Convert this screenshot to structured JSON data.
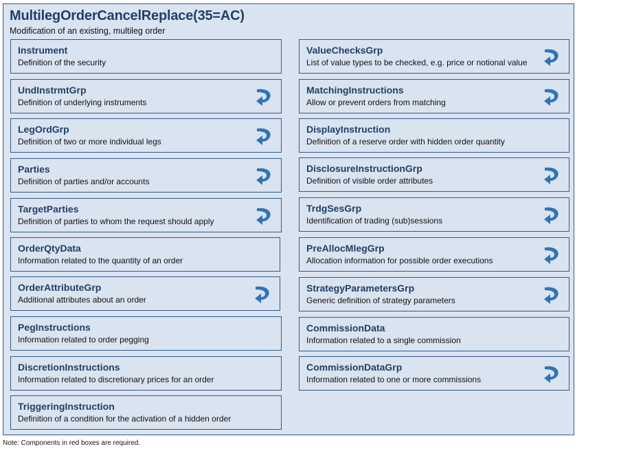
{
  "message": {
    "title": "MultilegOrderCancelReplace(35=AC)",
    "description": "Modification of an existing, multileg order"
  },
  "components_left": [
    {
      "name": "Instrument",
      "description": "Definition of the security",
      "repeating": false
    },
    {
      "name": "UndInstrmtGrp",
      "description": "Definition of underlying instruments",
      "repeating": true
    },
    {
      "name": "LegOrdGrp",
      "description": "Definition of two or more individual legs",
      "repeating": true
    },
    {
      "name": "Parties",
      "description": "Definition of parties and/or accounts",
      "repeating": true
    },
    {
      "name": "TargetParties",
      "description": "Definition of parties to whom the request should apply",
      "repeating": true
    },
    {
      "name": "OrderQtyData",
      "description": "Information related to the quantity of an order",
      "repeating": false
    },
    {
      "name": "OrderAttributeGrp",
      "description": "Additional attributes about an order",
      "repeating": true
    },
    {
      "name": "PegInstructions",
      "description": "Information related to order pegging",
      "repeating": false
    },
    {
      "name": "DiscretionInstructions",
      "description": "Information related to discretionary prices for an order",
      "repeating": false
    },
    {
      "name": "TriggeringInstruction",
      "description": "Definition of a condition for the activation of a hidden order",
      "repeating": false
    }
  ],
  "components_right": [
    {
      "name": "ValueChecksGrp",
      "description": "List of value types to be checked, e.g. price or notional value",
      "repeating": true
    },
    {
      "name": "MatchingInstructions",
      "description": "Allow or prevent orders from matching",
      "repeating": true
    },
    {
      "name": "DisplayInstruction",
      "description": "Definition of a reserve order with hidden order quantity",
      "repeating": false
    },
    {
      "name": "DisclosureInstructionGrp",
      "description": "Definition of visible order attributes",
      "repeating": true
    },
    {
      "name": "TrdgSesGrp",
      "description": "Identification of trading (sub)sessions",
      "repeating": true
    },
    {
      "name": "PreAllocMlegGrp",
      "description": "Allocation information for possible order executions",
      "repeating": true
    },
    {
      "name": "StrategyParametersGrp",
      "description": "Generic definition of strategy parameters",
      "repeating": true
    },
    {
      "name": "CommissionData",
      "description": "Information related to a single commission",
      "repeating": false
    },
    {
      "name": "CommissionDataGrp",
      "description": "Information related to one or more commissions",
      "repeating": true
    }
  ],
  "footnote": "Note: Components in red boxes are required.",
  "colors": {
    "border": "#2e5b8a",
    "fill": "#dae3f0",
    "title_text": "#1f3f66",
    "repeat_icon": "#2e75b6"
  }
}
